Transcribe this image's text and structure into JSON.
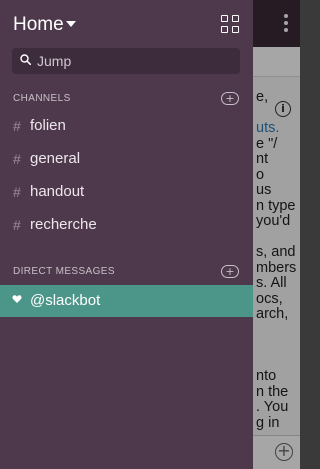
{
  "drawer": {
    "title": "Home",
    "search": {
      "placeholder": "Jump"
    },
    "channels_section": {
      "label": "CHANNELS",
      "items": [
        {
          "prefix": "#",
          "label": "folien"
        },
        {
          "prefix": "#",
          "label": "general"
        },
        {
          "prefix": "#",
          "label": "handout"
        },
        {
          "prefix": "#",
          "label": "recherche"
        }
      ]
    },
    "dm_section": {
      "label": "DIRECT MESSAGES",
      "items": [
        {
          "label": "@slackbot",
          "selected": true
        }
      ]
    },
    "add_glyph": "+"
  },
  "background": {
    "info_glyph": "i",
    "plus_glyph": "+",
    "text_lines": [
      "e,",
      "",
      "uts.",
      "e \"/",
      "nt",
      "o",
      "us",
      "n type",
      "you'd",
      "",
      "s, and",
      "mbers",
      "s. All",
      "ocs,",
      "arch,",
      "",
      "",
      "",
      "nto",
      "n the",
      ". You",
      "g in"
    ]
  },
  "colors": {
    "drawer_bg": "#4d394b",
    "selected_bg": "#4c9689",
    "link": "#2a80b9"
  }
}
